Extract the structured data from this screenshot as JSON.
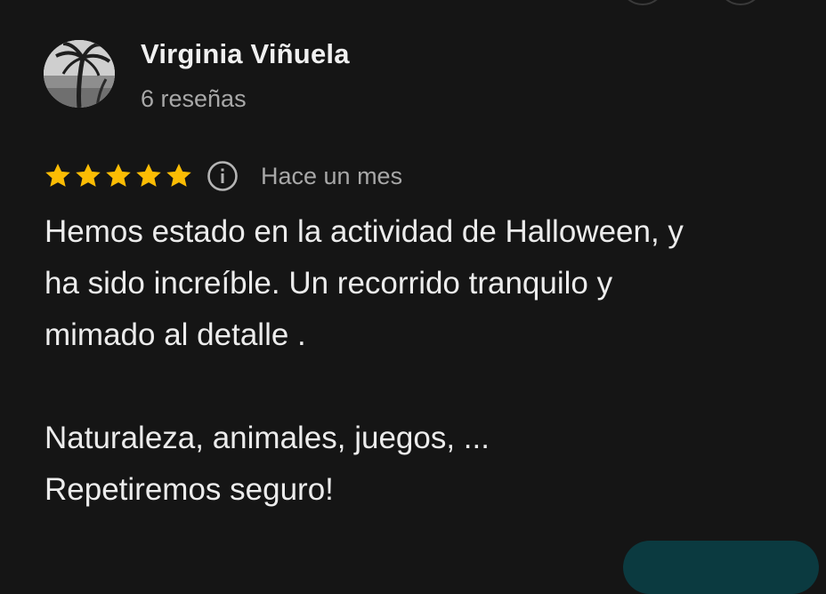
{
  "review": {
    "author": {
      "name": "Virginia Viñuela",
      "meta": "6 reseñas",
      "avatar_icon": "avatar-photo-palm-tree"
    },
    "rating": {
      "stars": 5,
      "max_stars": 5,
      "star_color": "#fbbc04",
      "info_icon": "info-icon"
    },
    "date": "Hace un mes",
    "text_lines": [
      "Hemos estado en la actividad de Halloween, y",
      "ha sido increíble. Un recorrido tranquilo y",
      "mimado al detalle ."
    ],
    "text_lines_2": [
      "Naturaleza, animales, juegos, ...",
      "Repetiremos seguro!"
    ]
  },
  "colors": {
    "background": "#151515",
    "text_primary": "#ececec",
    "text_secondary": "#a8a8a8",
    "accent_button": "#0b3a40"
  }
}
